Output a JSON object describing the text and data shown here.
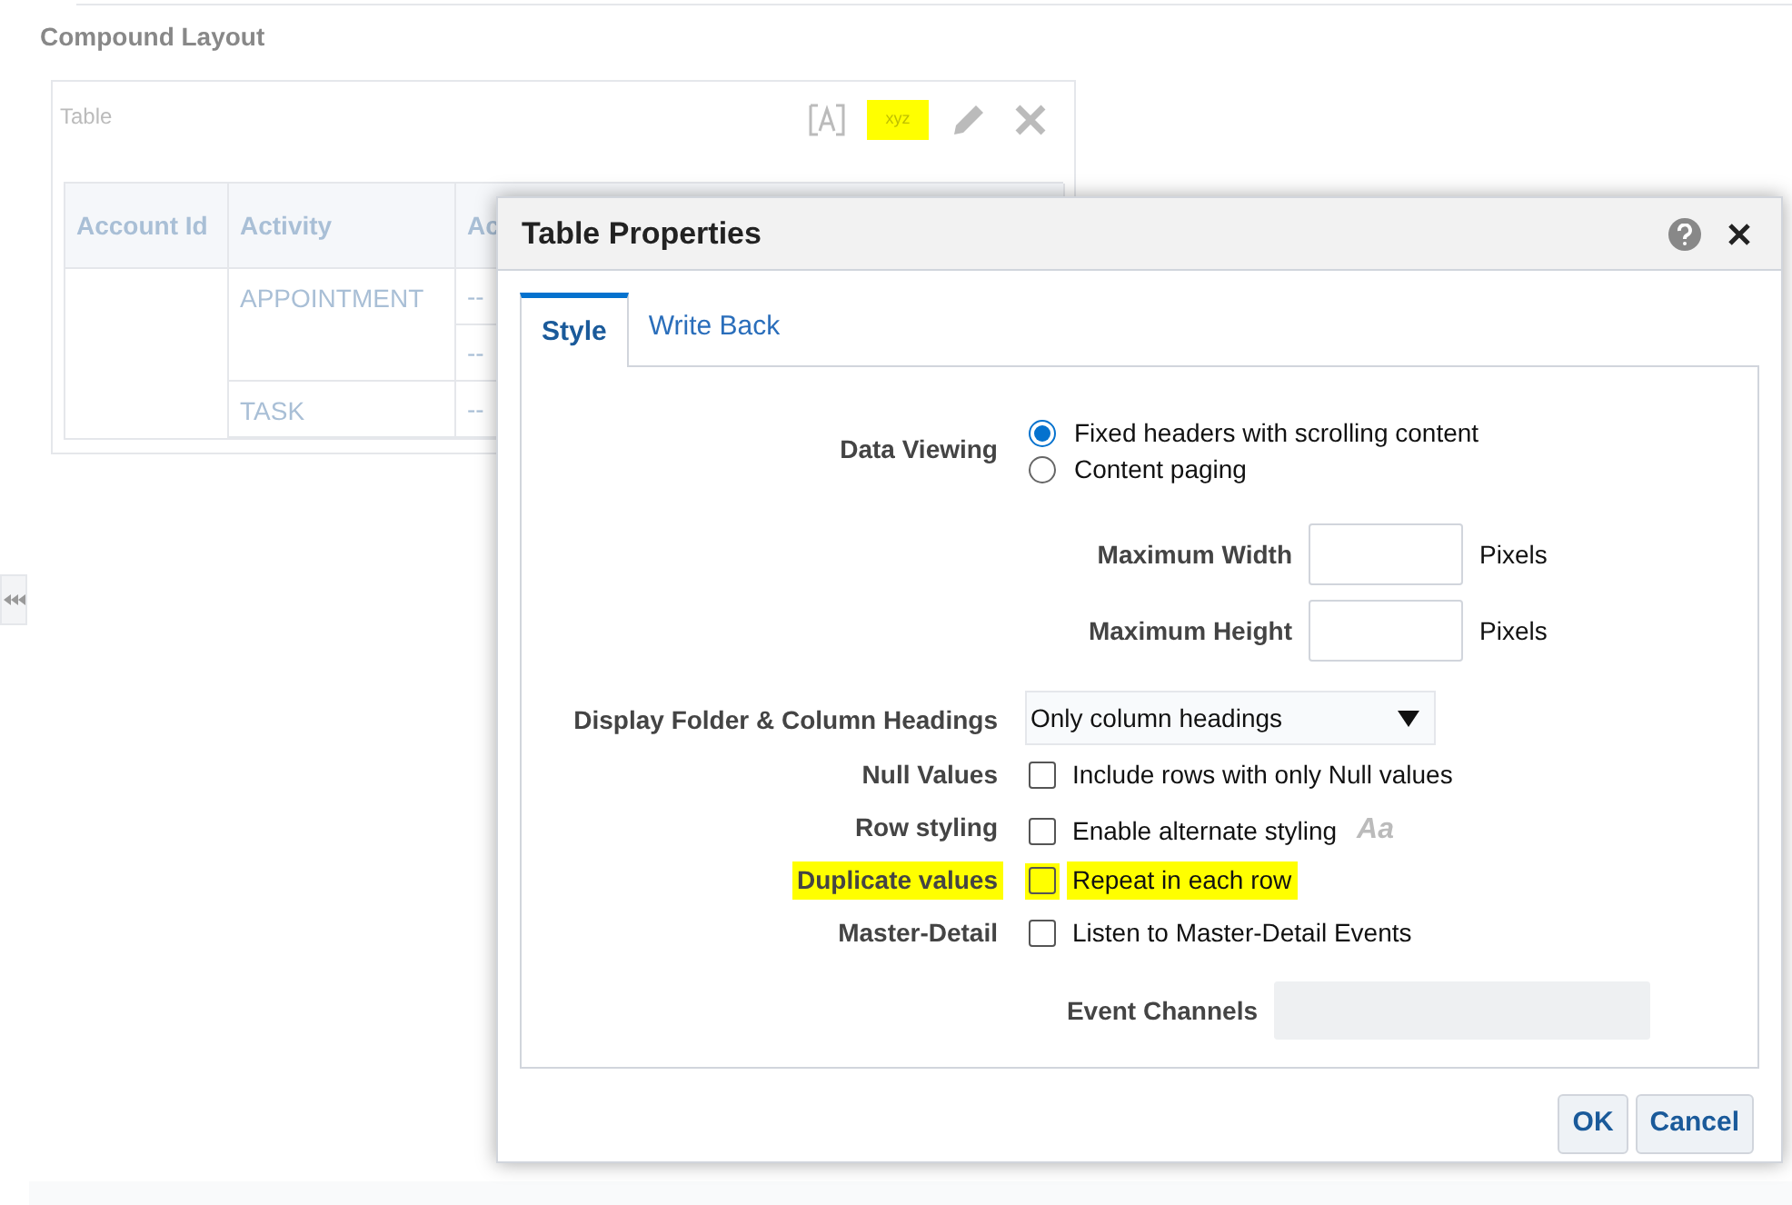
{
  "page": {
    "title": "Compound Layout"
  },
  "table_view": {
    "title": "Table",
    "toolbar": [
      {
        "kind": "format",
        "highlighted": false
      },
      {
        "kind": "text",
        "label": "xyz",
        "highlighted": true
      },
      {
        "kind": "edit",
        "highlighted": false
      },
      {
        "kind": "remove",
        "highlighted": false
      }
    ],
    "columns": [
      "Account Id",
      "Activity",
      "Ac"
    ],
    "groups": [
      {
        "activity": "APPOINTMENT",
        "values": [
          "--",
          "--"
        ]
      },
      {
        "activity": "TASK",
        "values": [
          "--"
        ]
      }
    ]
  },
  "dialog": {
    "title": "Table Properties",
    "tabs": [
      {
        "label": "Style",
        "selected": true
      },
      {
        "label": "Write Back",
        "selected": false
      }
    ],
    "rows": [
      {
        "kind": "radio",
        "label": "Data Viewing",
        "highlighted": false,
        "options": [
          {
            "label": "Fixed headers with scrolling content",
            "selected": true
          },
          {
            "label": "Content paging",
            "selected": false
          }
        ]
      },
      {
        "kind": "number",
        "label": "Maximum Width",
        "unit": "Pixels"
      },
      {
        "kind": "number",
        "label": "Maximum Height",
        "unit": "Pixels"
      },
      {
        "kind": "select",
        "label": "Display Folder & Column Headings",
        "value": "Only column headings"
      },
      {
        "kind": "checkbox",
        "label": "Null Values",
        "text": "Include rows with only Null values",
        "checked": false,
        "highlighted": false
      },
      {
        "kind": "checkbox",
        "label": "Row styling",
        "text": "Enable alternate styling",
        "checked": false,
        "highlighted": false,
        "style_icon": "Aa"
      },
      {
        "kind": "checkbox",
        "label": "Duplicate values",
        "text": "Repeat in each row",
        "checked": false,
        "highlighted": true
      },
      {
        "kind": "checkbox",
        "label": "Master-Detail",
        "text": "Listen to Master-Detail Events",
        "checked": false,
        "highlighted": false
      },
      {
        "kind": "field",
        "label": "Event Channels",
        "disabled": true
      }
    ],
    "buttons": [
      "OK",
      "Cancel"
    ]
  }
}
